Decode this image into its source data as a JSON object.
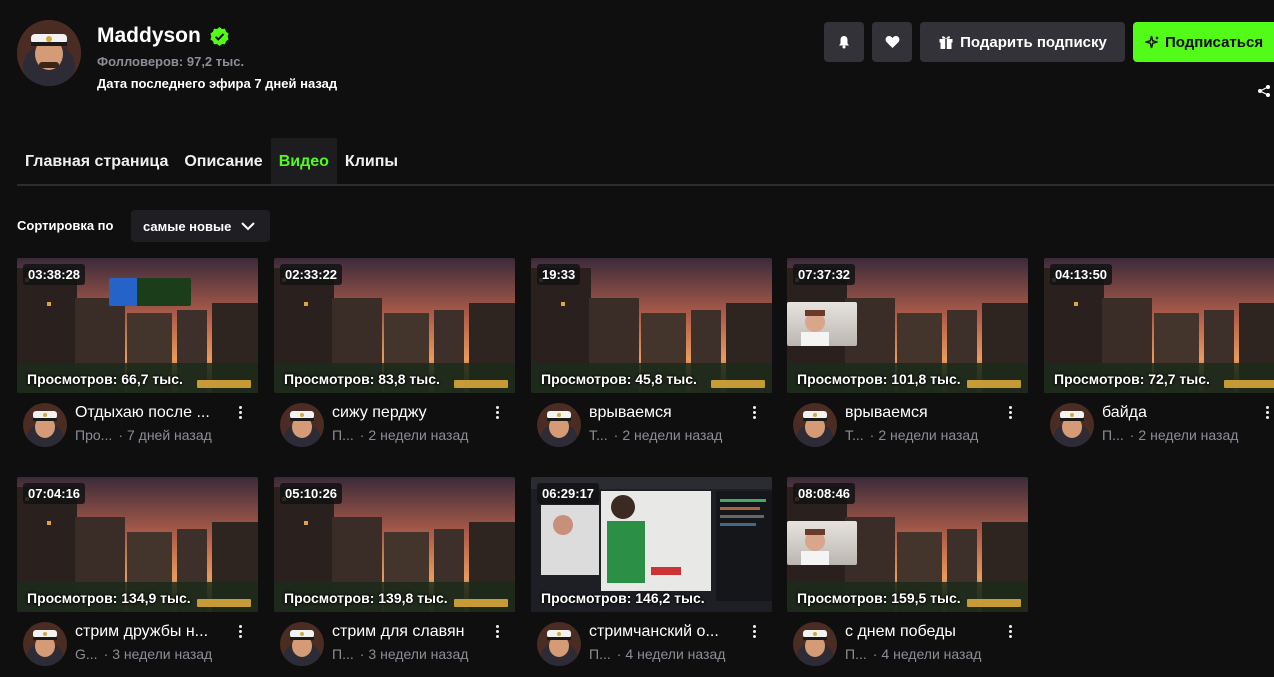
{
  "channel": {
    "name": "Maddyson",
    "followers": "Фолловеров: 97,2 тыс.",
    "last_stream": "Дата последнего эфира 7 дней назад"
  },
  "actions": {
    "bell_icon": "bell-icon",
    "heart_icon": "heart-icon",
    "gift_label": "Подарить подписку",
    "subscribe_label": "Подписаться",
    "accent": "#53fc18"
  },
  "tabs": [
    {
      "label": "Главная страница"
    },
    {
      "label": "Описание"
    },
    {
      "label": "Видео"
    },
    {
      "label": "Клипы"
    }
  ],
  "sort": {
    "label": "Сортировка по",
    "value": "самые новые"
  },
  "videos": [
    {
      "duration": "03:38:28",
      "views": "Просмотров: 66,7 тыс.",
      "title": "Отдыхаю после ...",
      "category": "Про...",
      "age": "7 дней назад"
    },
    {
      "duration": "02:33:22",
      "views": "Просмотров: 83,8 тыс.",
      "title": "сижу перджу",
      "category": "П...",
      "age": "2 недели назад"
    },
    {
      "duration": "19:33",
      "views": "Просмотров: 45,8 тыс.",
      "title": "врываемся",
      "category": "Т...",
      "age": "2 недели назад"
    },
    {
      "duration": "07:37:32",
      "views": "Просмотров: 101,8 тыс.",
      "title": "врываемся",
      "category": "Т...",
      "age": "2 недели назад"
    },
    {
      "duration": "04:13:50",
      "views": "Просмотров: 72,7 тыс.",
      "title": "байда",
      "category": "П...",
      "age": "2 недели назад"
    },
    {
      "duration": "07:04:16",
      "views": "Просмотров: 134,9 тыс.",
      "title": "стрим дружбы н...",
      "category": "G...",
      "age": "3 недели назад"
    },
    {
      "duration": "05:10:26",
      "views": "Просмотров: 139,8 тыс.",
      "title": "стрим для славян",
      "category": "П...",
      "age": "3 недели назад"
    },
    {
      "duration": "06:29:17",
      "views": "Просмотров: 146,2 тыс.",
      "title": "стримчанский о...",
      "category": "П...",
      "age": "4 недели назад"
    },
    {
      "duration": "08:08:46",
      "views": "Просмотров: 159,5 тыс.",
      "title": "с днем победы",
      "category": "П...",
      "age": "4 недели назад"
    }
  ]
}
